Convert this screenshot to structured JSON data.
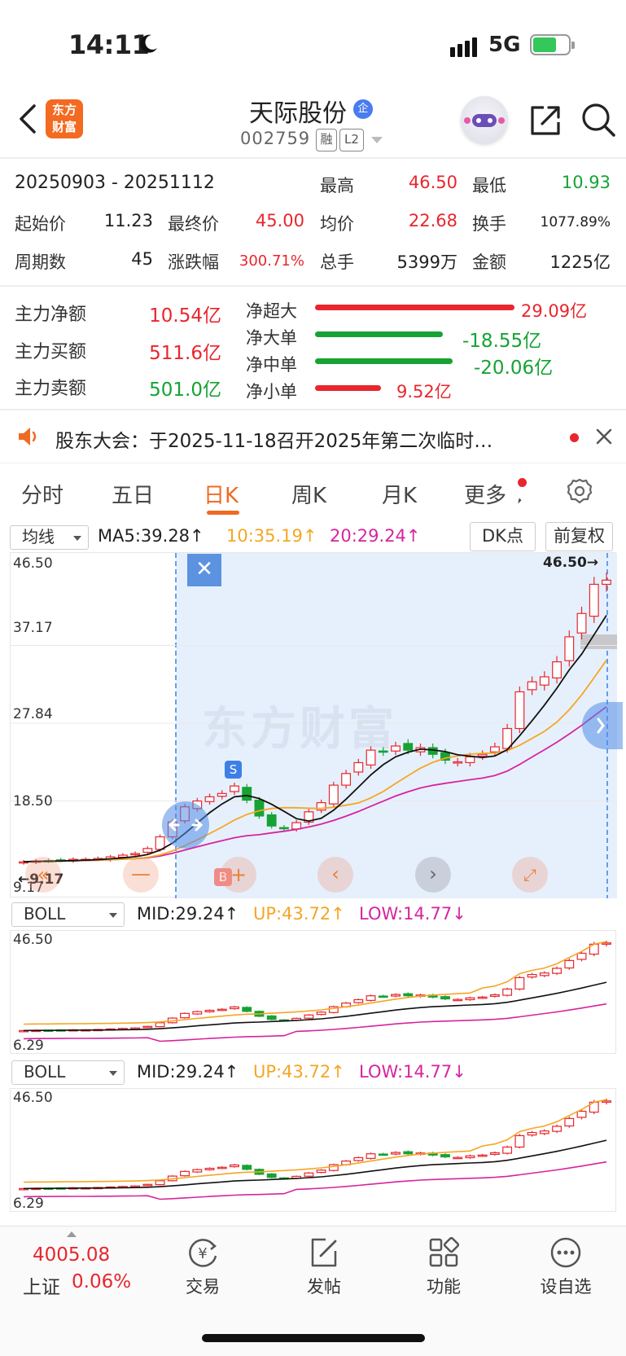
{
  "status_bar": {
    "time": "14:11",
    "network": "5G"
  },
  "header": {
    "logo_line1": "东方",
    "logo_line2": "财富",
    "stock_name": "天际股份",
    "badge": "企",
    "stock_code": "002759",
    "tags": [
      "融",
      "L2"
    ]
  },
  "summary": {
    "date_range": "20250903 - 20251112",
    "high_label": "最高",
    "high": "46.50",
    "low_label": "最低",
    "low": "10.93",
    "start_label": "起始价",
    "start": "11.23",
    "end_label": "最终价",
    "end": "45.00",
    "avg_label": "均价",
    "avg": "22.68",
    "turnover_label": "换手",
    "turnover": "1077.89%",
    "periods_label": "周期数",
    "periods": "45",
    "change_label": "涨跌幅",
    "change": "300.71%",
    "volume_label": "总手",
    "volume": "5399万",
    "amount_label": "金额",
    "amount": "1225亿"
  },
  "fund_flow": {
    "main_net_label": "主力净额",
    "main_net": "10.54亿",
    "main_buy_label": "主力买额",
    "main_buy": "511.6亿",
    "main_sell_label": "主力卖额",
    "main_sell": "501.0亿",
    "bars": [
      {
        "label": "净超大",
        "value": "29.09亿",
        "ratio": 1.0,
        "color": "#e8262d"
      },
      {
        "label": "净大单",
        "value": "-18.55亿",
        "ratio": 0.64,
        "color": "#16a334"
      },
      {
        "label": "净中单",
        "value": "-20.06亿",
        "ratio": 0.69,
        "color": "#16a334"
      },
      {
        "label": "净小单",
        "value": "9.52亿",
        "ratio": 0.33,
        "color": "#e8262d"
      }
    ]
  },
  "notice": {
    "text": "股东大会：于2025-11-18召开2025年第二次临时…"
  },
  "tabs": [
    "分时",
    "五日",
    "日K",
    "周K",
    "月K",
    "更多"
  ],
  "active_tab": "日K",
  "indicator_row": {
    "selector": "均线",
    "ma5": "MA5:39.28↑",
    "ma10": "10:35.19↑",
    "ma20": "20:29.24↑",
    "dk_button": "DK点",
    "adjust_button": "前复权"
  },
  "main_chart": {
    "y_labels": [
      "46.50",
      "37.17",
      "27.84",
      "18.50",
      "9.17"
    ],
    "high_marker": "46.50→",
    "low_marker": "←9.17",
    "watermark": "东方财富",
    "s_marker": "S",
    "b_marker": "B"
  },
  "boll_panel_1": {
    "selector": "BOLL",
    "mid": "MID:29.24↑",
    "up": "UP:43.72↑",
    "low": "LOW:14.77↓",
    "y_top": "46.50",
    "y_bottom": "6.29"
  },
  "boll_panel_2": {
    "selector": "BOLL",
    "mid": "MID:29.24↑",
    "up": "UP:43.72↑",
    "low": "LOW:14.77↓",
    "y_top": "46.50",
    "y_bottom": "6.29"
  },
  "bottom_nav": {
    "index_value": "4005.08",
    "index_name": "上证",
    "index_change": "0.06%",
    "items": [
      "交易",
      "发帖",
      "功能",
      "设自选"
    ]
  },
  "colors": {
    "up": "#e8262d",
    "down": "#16a334",
    "accent": "#f06a24",
    "ma10": "#f5a623",
    "ma20": "#d6249f",
    "select_bg": "#e6f0fc"
  },
  "chart_data": {
    "type": "candlestick",
    "closes": [
      11.2,
      11.3,
      11.3,
      11.4,
      11.5,
      11.5,
      11.6,
      11.8,
      12.0,
      12.2,
      12.8,
      14.2,
      16.0,
      17.8,
      18.5,
      19.0,
      19.4,
      20.3,
      18.6,
      16.7,
      15.5,
      15.2,
      15.9,
      17.2,
      18.3,
      20.4,
      21.8,
      23.1,
      24.6,
      24.4,
      25.1,
      24.6,
      24.9,
      24.1,
      23.4,
      23.2,
      23.8,
      24.1,
      25.0,
      27.2,
      31.6,
      32.8,
      33.4,
      35.2,
      38.2,
      41.0,
      44.5,
      45.0
    ],
    "ylim": [
      9.17,
      46.5
    ]
  }
}
